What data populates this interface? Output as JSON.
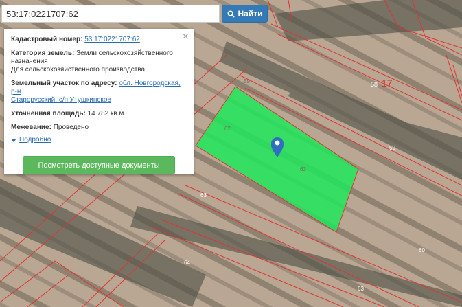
{
  "search": {
    "value": "53:17:0221707:62",
    "button_label": "Найти"
  },
  "map": {
    "parcel_labels": [
      "62",
      "63",
      "59",
      "58",
      "17",
      "59",
      "63",
      "64",
      "63",
      "60"
    ],
    "parcel_color": "#1ee85a"
  },
  "panel": {
    "cadastral_label": "Кадастровый номер:",
    "cadastral_value": "53:17:0221707:62",
    "category_label": "Категория земель:",
    "category_value_1": "Земли сельскохозяйственного",
    "category_value_2": "назначения",
    "category_value_3": "Для сельскохозяйственного производства",
    "address_label": "Земельный участок по адресу:",
    "address_value_1": "обл. Новгородская, р-н",
    "address_value_2": "Старорусский, с/п Утушкинское",
    "area_label": "Уточненная площадь:",
    "area_value": "14 782 кв.м.",
    "survey_label": "Межевание:",
    "survey_value": "Проведено",
    "more_label": "Подробно",
    "docs_button": "Посмотреть доступные документы",
    "close_symbol": "×"
  }
}
